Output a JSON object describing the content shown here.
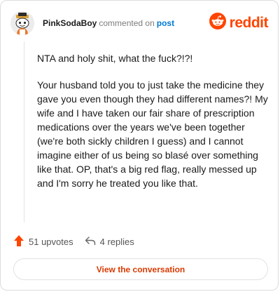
{
  "header": {
    "username": "PinkSodaBoy",
    "action": "commented on",
    "post_link": "post",
    "avatar_icon": "snoo-avatar-icon"
  },
  "brand": {
    "logo_icon": "reddit-logo-icon",
    "wordmark": "reddit",
    "color": "#ff4500"
  },
  "comment": {
    "paragraphs": [
      "NTA and holy shit, what the fuck?!?!",
      "Your husband told you to just take the medicine they gave you even though they had different names?! My wife and I have taken our fair share of prescription medications over the years we've been together (we're both sickly children I guess) and I cannot imagine either of us being so blasé over something like that. OP, that's a big red flag, really messed up and I'm sorry he treated you like that."
    ]
  },
  "footer": {
    "upvotes": "51 upvotes",
    "replies": "4 replies",
    "upvote_icon": "upvote-arrow-icon",
    "reply_icon": "reply-arrow-icon"
  },
  "cta": {
    "label": "View the conversation",
    "color": "#d93a00"
  }
}
